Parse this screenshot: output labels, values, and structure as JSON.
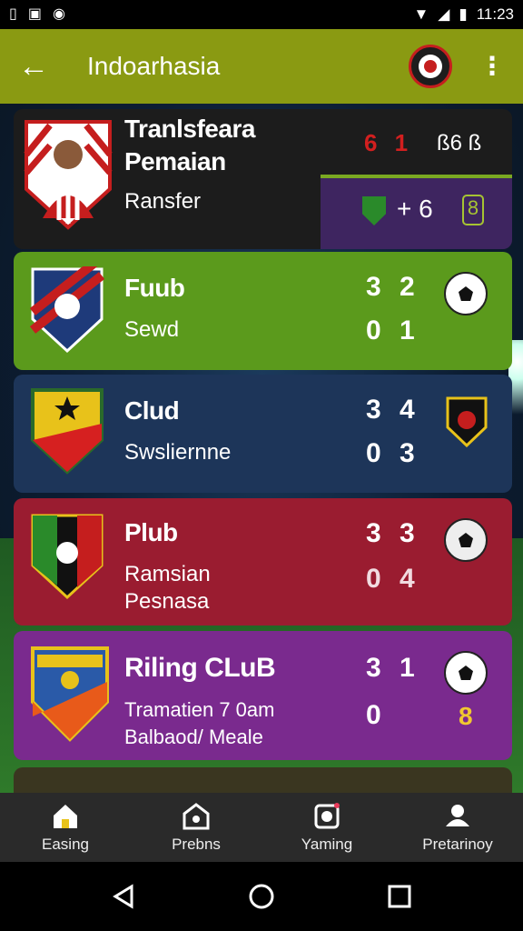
{
  "status_bar": {
    "time": "11:23"
  },
  "app_bar": {
    "title": "Indoarhasia"
  },
  "top_card": {
    "title_line1": "Tranlsfeara",
    "title_line2": "Pemaian",
    "subtitle": "Ransfer",
    "score_red": "6 1",
    "score_white": "ß6 ß",
    "mini_score": "+ 6",
    "mini_badge": "8"
  },
  "cards": [
    {
      "title": "Fuub",
      "subtitle": "Sewd",
      "score_top": "3 2",
      "score_bottom": "0 1",
      "color": "#5b9a1c"
    },
    {
      "title": "Clud",
      "subtitle": "Swsliernne",
      "score_top": "3 4",
      "score_bottom": "0 3",
      "color": "#1d3559"
    },
    {
      "title": "Plub",
      "subtitle": "Ramsian",
      "subtitle2": "Pesnasa",
      "score_top": "3 3",
      "score_bottom": "0 4",
      "color": "#9a1c30"
    },
    {
      "title": "Riling CLuB",
      "subtitle": "Tramatien 7 0am",
      "subtitle2": "Balbaod/ Meale",
      "score_top": "3 1",
      "score_bottom": "0",
      "badge": "8",
      "color": "#7a2a8e"
    }
  ],
  "bottom_nav": {
    "items": [
      {
        "label": "Easing",
        "icon": "home-icon"
      },
      {
        "label": "Prebns",
        "icon": "shop-icon"
      },
      {
        "label": "Yaming",
        "icon": "trophy-icon"
      },
      {
        "label": "Pretarinoy",
        "icon": "profile-icon"
      }
    ]
  }
}
